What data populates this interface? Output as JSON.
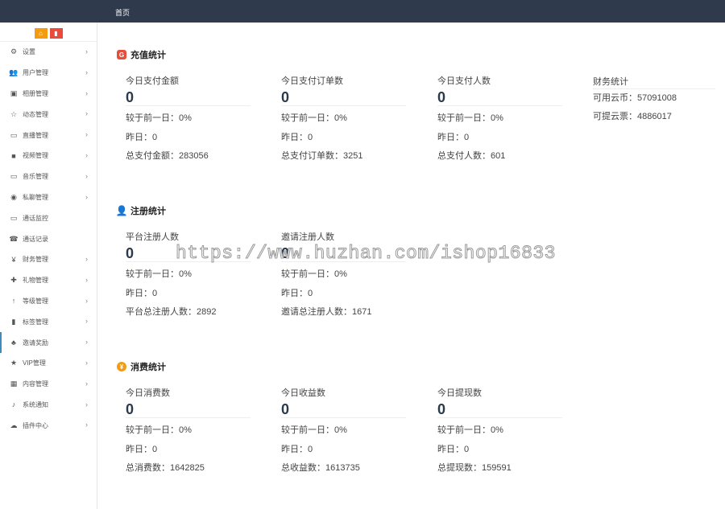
{
  "topbar": {
    "home_tab": "首页"
  },
  "sidebar": {
    "top_buttons": [
      {
        "icon": "home-icon",
        "glyph": "⌂"
      },
      {
        "icon": "bookmark-icon",
        "glyph": "▮"
      }
    ],
    "items": [
      {
        "label": "设置",
        "icon": "gears-icon",
        "glyph": "⚙",
        "arrow": true
      },
      {
        "label": "用户管理",
        "icon": "users-icon",
        "glyph": "👥",
        "arrow": true
      },
      {
        "label": "相册管理",
        "icon": "image-icon",
        "glyph": "▣",
        "arrow": true
      },
      {
        "label": "动态管理",
        "icon": "star-outline-icon",
        "glyph": "☆",
        "arrow": true
      },
      {
        "label": "直播管理",
        "icon": "monitor-icon",
        "glyph": "▭",
        "arrow": true
      },
      {
        "label": "视频管理",
        "icon": "video-icon",
        "glyph": "■",
        "arrow": true
      },
      {
        "label": "音乐管理",
        "icon": "desktop-icon",
        "glyph": "▭",
        "arrow": true
      },
      {
        "label": "私聊管理",
        "icon": "telegram-icon",
        "glyph": "◉",
        "arrow": true
      },
      {
        "label": "通话监控",
        "icon": "screen-icon",
        "glyph": "▭",
        "arrow": false
      },
      {
        "label": "通话记录",
        "icon": "phone-icon",
        "glyph": "☎",
        "arrow": false
      },
      {
        "label": "财务管理",
        "icon": "yen-icon",
        "glyph": "¥",
        "arrow": true
      },
      {
        "label": "礼物管理",
        "icon": "gift-icon",
        "glyph": "✚",
        "arrow": true
      },
      {
        "label": "等级管理",
        "icon": "level-icon",
        "glyph": "↑",
        "arrow": true
      },
      {
        "label": "标签管理",
        "icon": "tag-icon",
        "glyph": "▮",
        "arrow": true
      },
      {
        "label": "邀请奖励",
        "icon": "sitemap-icon",
        "glyph": "♣",
        "arrow": true
      },
      {
        "label": "VIP管理",
        "icon": "star-icon",
        "glyph": "★",
        "arrow": true
      },
      {
        "label": "内容管理",
        "icon": "grid-icon",
        "glyph": "▦",
        "arrow": true
      },
      {
        "label": "系统通知",
        "icon": "bell-icon",
        "glyph": "♪",
        "arrow": true
      },
      {
        "label": "插件中心",
        "icon": "cloud-icon",
        "glyph": "☁",
        "arrow": true
      }
    ]
  },
  "recharge": {
    "title": "充值统计",
    "icon_color": "#e74c3c",
    "cards": [
      {
        "label": "今日支付金额",
        "value": "0",
        "compare": "较于前一日：0%",
        "yesterday": "昨日：0",
        "total": "总支付金额：283056"
      },
      {
        "label": "今日支付订单数",
        "value": "0",
        "compare": "较于前一日：0%",
        "yesterday": "昨日：0",
        "total": "总支付订单数：3251"
      },
      {
        "label": "今日支付人数",
        "value": "0",
        "compare": "较于前一日：0%",
        "yesterday": "昨日：0",
        "total": "总支付人数：601"
      }
    ],
    "finance": {
      "title": "财务统计",
      "coins": "可用云币：57091008",
      "tickets": "可提云票：4886017"
    }
  },
  "register": {
    "title": "注册统计",
    "icon_color": "#1abc9c",
    "cards": [
      {
        "label": "平台注册人数",
        "value": "0",
        "compare": "较于前一日：0%",
        "yesterday": "昨日：0",
        "total": "平台总注册人数：2892"
      },
      {
        "label": "邀请注册人数",
        "value": "0",
        "compare": "较于前一日：0%",
        "yesterday": "昨日：0",
        "total": "邀请总注册人数：1671"
      }
    ]
  },
  "consume": {
    "title": "消费统计",
    "icon_color": "#f39c12",
    "cards": [
      {
        "label": "今日消费数",
        "value": "0",
        "compare": "较于前一日：0%",
        "yesterday": "昨日：0",
        "total": "总消费数：1642825"
      },
      {
        "label": "今日收益数",
        "value": "0",
        "compare": "较于前一日：0%",
        "yesterday": "昨日：0",
        "total": "总收益数：1613735"
      },
      {
        "label": "今日提现数",
        "value": "0",
        "compare": "较于前一日：0%",
        "yesterday": "昨日：0",
        "total": "总提现数：159591"
      }
    ]
  },
  "watermark": "https://www.huzhan.com/ishop16833"
}
